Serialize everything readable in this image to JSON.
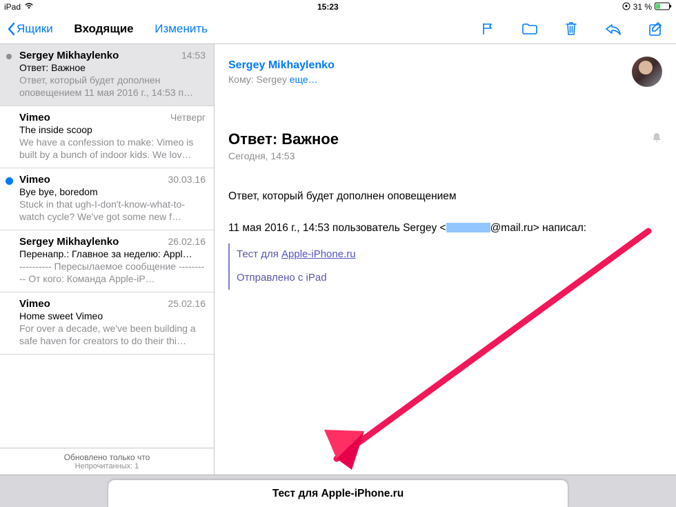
{
  "statusbar": {
    "device": "iPad",
    "time": "15:23",
    "battery_pct": "31 %"
  },
  "toolbar": {
    "back_label": "Ящики",
    "title": "Входящие",
    "edit_label": "Изменить"
  },
  "sidebar": {
    "items": [
      {
        "from": "Sergey Mikhaylenko",
        "date": "14:53",
        "subject": "Ответ: Важное",
        "preview": "Ответ, который будет дополнен оповещением 11 мая 2016 г., 14:53 п…",
        "selected": true,
        "unread": false
      },
      {
        "from": "Vimeo",
        "date": "Четверг",
        "subject": "The inside scoop",
        "preview": "We have a confession to make: Vimeo is built by a bunch of indoor kids. We lov…",
        "selected": false,
        "unread": false
      },
      {
        "from": "Vimeo",
        "date": "30.03.16",
        "subject": "Bye bye, boredom",
        "preview": "Stuck in that ugh-I-don't-know-what-to-watch cycle? We've got some new f…",
        "selected": false,
        "unread": true
      },
      {
        "from": "Sergey Mikhaylenko",
        "date": "26.02.16",
        "subject": "Перенапр.: Главное за неделю: Appl…",
        "preview": "---------- Пересылаемое сообщение ---------- От кого: Команда Apple-iP…",
        "selected": false,
        "unread": false
      },
      {
        "from": "Vimeo",
        "date": "25.02.16",
        "subject": "Home sweet Vimeo",
        "preview": "For over a decade, we've been building a safe haven for creators to do their thi…",
        "selected": false,
        "unread": false
      }
    ],
    "footer_main": "Обновлено только что",
    "footer_sub": "Непрочитанных: 1"
  },
  "detail": {
    "from": "Sergey Mikhaylenko",
    "to_label": "Кому:",
    "to_value": "Sergey",
    "more_label": "еще…",
    "subject": "Ответ: Важное",
    "date": "Сегодня, 14:53",
    "body_line1": "Ответ, который будет дополнен оповещением",
    "body_line2_a": "11 мая 2016 г., 14:53 пользователь Sergey <",
    "body_line2_b": "@mail.ru> написал:",
    "quote_prefix": "Тест для ",
    "quote_link": "Apple-iPhone.ru",
    "quote_sent": "Отправлено с iPad"
  },
  "notification": {
    "text": "Тест для Apple-iPhone.ru"
  }
}
